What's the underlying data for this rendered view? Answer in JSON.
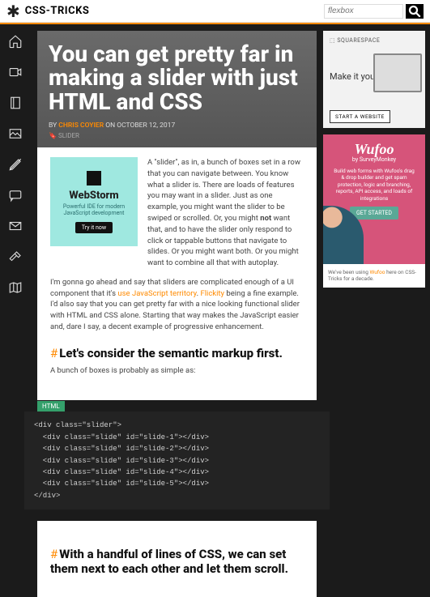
{
  "header": {
    "logo_text": "CSS-TRICKS",
    "search_placeholder": "flexbox"
  },
  "article": {
    "title": "You can get pretty far in making a slider with just HTML and CSS",
    "byline_prefix": "BY",
    "author": "CHRIS COYIER",
    "byline_on": "ON OCTOBER 12, 2017",
    "tag": "SLIDER",
    "webstorm": {
      "title": "WebStorm",
      "subtitle": "Powerful IDE for modern JavaScript development",
      "button": "Try it now"
    },
    "intro": "A \"slider\", as in, a bunch of boxes set in a row that you can navigate between. You know what a slider is. There are loads of features you may want in a slider. Just as one example, you might want the slider to be swiped or scrolled. Or, you might not want that, and to have the slider only respond to click or tappable buttons that navigate to slides. Or you might want both. Or you might want to combine all that with autoplay.",
    "intro_em": "not",
    "p2_a": "I'm gonna go ahead and say that sliders are complicated enough of a UI component that it's ",
    "p2_link1": "use JavaScript territory",
    "p2_b": ". ",
    "p2_link2": "Flickity",
    "p2_c": " being a fine example. I'd also say that you can get pretty far with a nice looking functional slider with HTML and CSS alone. Starting that way makes the JavaScript easier and, dare I say, a decent example of progressive enhancement.",
    "h2_1": "Let's consider the semantic markup first.",
    "p3": "A bunch of boxes is probably as simple as:",
    "code_label": "HTML",
    "code": [
      "<div class=\"slider\">",
      "  <div class=\"slide\" id=\"slide-1\"></div>",
      "  <div class=\"slide\" id=\"slide-2\"></div>",
      "  <div class=\"slide\" id=\"slide-3\"></div>",
      "  <div class=\"slide\" id=\"slide-4\"></div>",
      "  <div class=\"slide\" id=\"slide-5\"></div>",
      "</div>"
    ],
    "h2_2": "With a handful of lines of CSS, we can set them next to each other and let them scroll."
  },
  "ads": {
    "squarespace": {
      "brand": "⬚ SQUARESPACE",
      "text": "Make it your own.",
      "button": "START A WEBSITE"
    },
    "wufoo": {
      "title": "Wufoo",
      "subtitle": "by SurveyMonkey",
      "body": "Build web forms with Wufoo's drag & drop builder and get spam protection, logic and branching, reports, API access, and loads of integrations",
      "button": "GET STARTED",
      "note_a": "We've been using ",
      "note_link": "Wufoo",
      "note_b": " here on CSS-Tricks for a decade."
    }
  }
}
